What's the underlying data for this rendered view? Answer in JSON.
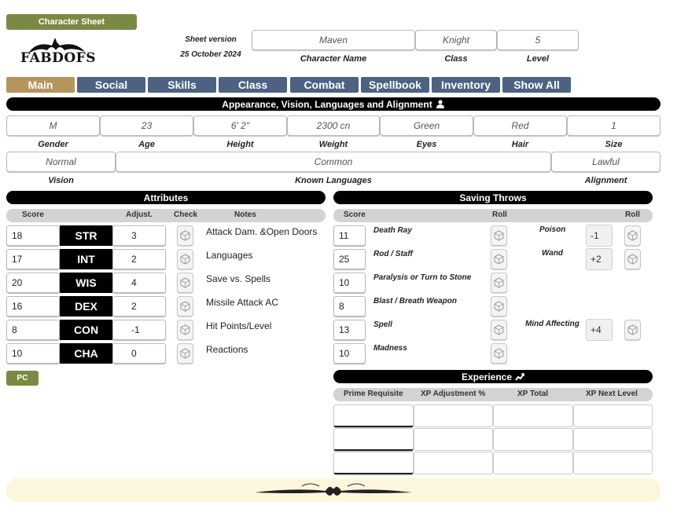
{
  "header": {
    "badge": "Character Sheet",
    "logo": "FABDOFS",
    "sheet_version_label": "Sheet version",
    "sheet_version_date": "25 October 2024",
    "character_name": "Maven",
    "class": "Knight",
    "level": "5",
    "character_name_label": "Character Name",
    "class_label": "Class",
    "level_label": "Level"
  },
  "tabs": [
    "Main",
    "Social",
    "Skills",
    "Class",
    "Combat",
    "Spellbook",
    "Inventory",
    "Show All"
  ],
  "appearance": {
    "title": "Appearance, Vision, Languages and Alignment",
    "fields": [
      {
        "label": "Gender",
        "value": "M"
      },
      {
        "label": "Age",
        "value": "23"
      },
      {
        "label": "Height",
        "value": "6' 2\""
      },
      {
        "label": "Weight",
        "value": "2300 cn"
      },
      {
        "label": "Eyes",
        "value": "Green"
      },
      {
        "label": "Hair",
        "value": "Red"
      },
      {
        "label": "Size",
        "value": "1"
      }
    ],
    "vision_label": "Vision",
    "vision": "Normal",
    "languages_label": "Known Languages",
    "languages": "Common",
    "alignment_label": "Alignment",
    "alignment": "Lawful"
  },
  "attributes": {
    "title": "Attributes",
    "col_score": "Score",
    "col_adjust": "Adjust.",
    "col_check": "Check",
    "col_notes": "Notes",
    "rows": [
      {
        "score": "18",
        "name": "STR",
        "adjust": "3",
        "note": "Attack Dam. &Open Doors"
      },
      {
        "score": "17",
        "name": "INT",
        "adjust": "2",
        "note": "Languages"
      },
      {
        "score": "20",
        "name": "WIS",
        "adjust": "4",
        "note": "Save vs. Spells"
      },
      {
        "score": "16",
        "name": "DEX",
        "adjust": "2",
        "note": "Missile Attack AC"
      },
      {
        "score": "8",
        "name": "CON",
        "adjust": "-1",
        "note": "Hit Points/Level"
      },
      {
        "score": "10",
        "name": "CHA",
        "adjust": "0",
        "note": "Reactions"
      }
    ]
  },
  "pc_button": "PC",
  "saving_throws": {
    "title": "Saving Throws",
    "col_score": "Score",
    "col_roll": "Roll",
    "col_roll2": "Roll",
    "rows": [
      {
        "score": "11",
        "name": "Death Ray"
      },
      {
        "score": "25",
        "name": "Rod / Staff"
      },
      {
        "score": "10",
        "name": "Paralysis or Turn to Stone"
      },
      {
        "score": "8",
        "name": "Blast / Breath Weapon"
      },
      {
        "score": "13",
        "name": "Spell"
      },
      {
        "score": "10",
        "name": "Madness"
      }
    ],
    "extra": [
      {
        "name": "Poison",
        "value": "-1"
      },
      {
        "name": "Wand",
        "value": "+2"
      },
      {
        "name": "Mind Affecting",
        "value": "+4"
      }
    ]
  },
  "experience": {
    "title": "Experience",
    "col_prime": "Prime Requisite",
    "col_adjust": "XP Adjustment %",
    "col_total": "XP Total",
    "col_next": "XP Next Level"
  }
}
